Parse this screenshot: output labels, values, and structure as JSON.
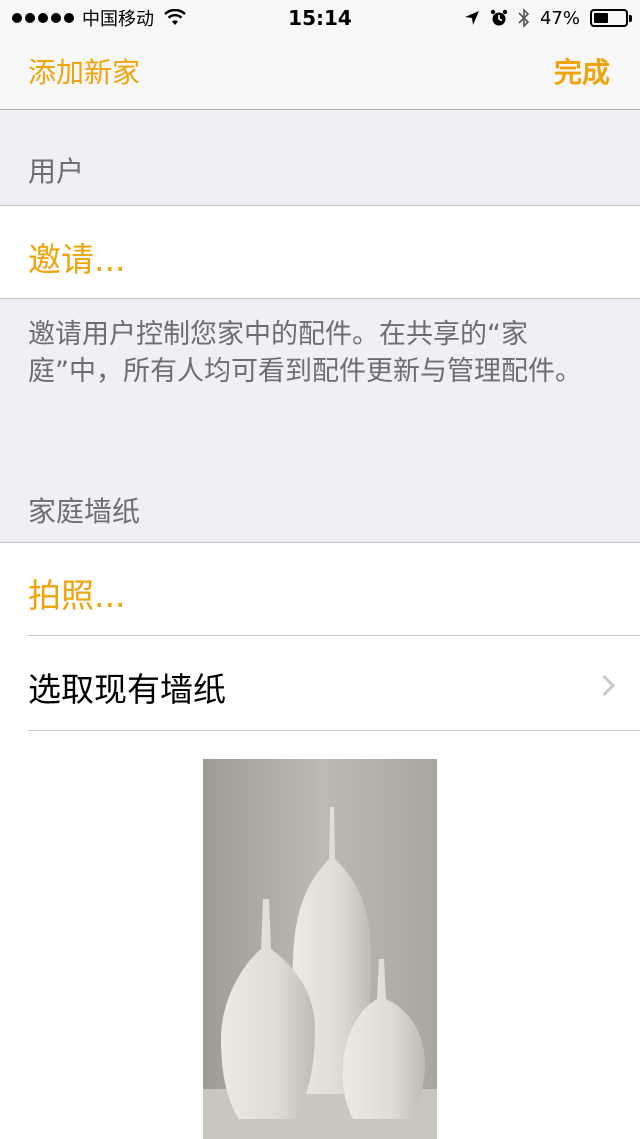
{
  "status_bar": {
    "carrier": "中国移动",
    "time": "15:14",
    "battery_percent": "47%",
    "battery_level": 0.47,
    "icons": [
      "signal-dots-icon",
      "wifi-icon",
      "location-arrow-icon",
      "alarm-icon",
      "bluetooth-icon",
      "battery-icon"
    ]
  },
  "nav": {
    "left_label": "添加新家",
    "right_label": "完成"
  },
  "users_section": {
    "header": "用户",
    "invite_label": "邀请...",
    "footer": "邀请用户控制您家中的配件。在共享的“家庭”中，所有人均可看到配件更新与管理配件。"
  },
  "wallpaper_section": {
    "header": "家庭墙纸",
    "take_photo_label": "拍照...",
    "choose_existing_label": "选取现有墙纸"
  },
  "colors": {
    "accent": "#f0a30a",
    "group_background": "#efeff4",
    "separator": "#c8c7cc",
    "secondary_text": "#6d6d72"
  }
}
